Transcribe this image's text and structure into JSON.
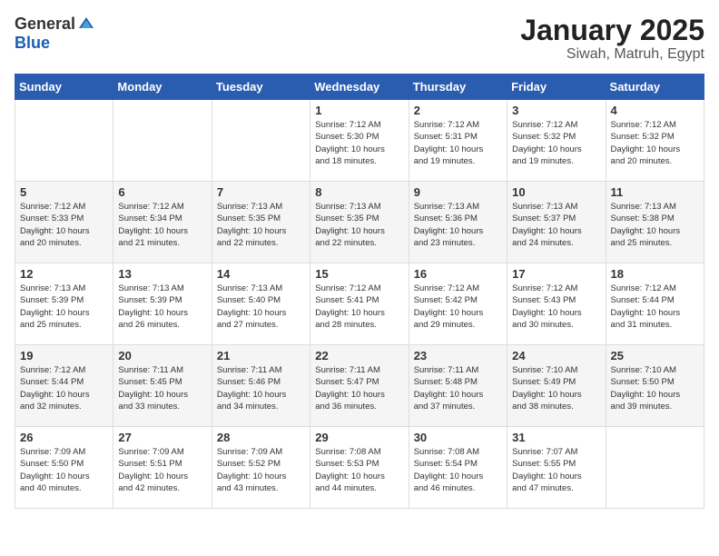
{
  "header": {
    "logo_general": "General",
    "logo_blue": "Blue",
    "month": "January 2025",
    "location": "Siwah, Matruh, Egypt"
  },
  "days_of_week": [
    "Sunday",
    "Monday",
    "Tuesday",
    "Wednesday",
    "Thursday",
    "Friday",
    "Saturday"
  ],
  "weeks": [
    [
      {
        "day": "",
        "info": ""
      },
      {
        "day": "",
        "info": ""
      },
      {
        "day": "",
        "info": ""
      },
      {
        "day": "1",
        "info": "Sunrise: 7:12 AM\nSunset: 5:30 PM\nDaylight: 10 hours\nand 18 minutes."
      },
      {
        "day": "2",
        "info": "Sunrise: 7:12 AM\nSunset: 5:31 PM\nDaylight: 10 hours\nand 19 minutes."
      },
      {
        "day": "3",
        "info": "Sunrise: 7:12 AM\nSunset: 5:32 PM\nDaylight: 10 hours\nand 19 minutes."
      },
      {
        "day": "4",
        "info": "Sunrise: 7:12 AM\nSunset: 5:32 PM\nDaylight: 10 hours\nand 20 minutes."
      }
    ],
    [
      {
        "day": "5",
        "info": "Sunrise: 7:12 AM\nSunset: 5:33 PM\nDaylight: 10 hours\nand 20 minutes."
      },
      {
        "day": "6",
        "info": "Sunrise: 7:12 AM\nSunset: 5:34 PM\nDaylight: 10 hours\nand 21 minutes."
      },
      {
        "day": "7",
        "info": "Sunrise: 7:13 AM\nSunset: 5:35 PM\nDaylight: 10 hours\nand 22 minutes."
      },
      {
        "day": "8",
        "info": "Sunrise: 7:13 AM\nSunset: 5:35 PM\nDaylight: 10 hours\nand 22 minutes."
      },
      {
        "day": "9",
        "info": "Sunrise: 7:13 AM\nSunset: 5:36 PM\nDaylight: 10 hours\nand 23 minutes."
      },
      {
        "day": "10",
        "info": "Sunrise: 7:13 AM\nSunset: 5:37 PM\nDaylight: 10 hours\nand 24 minutes."
      },
      {
        "day": "11",
        "info": "Sunrise: 7:13 AM\nSunset: 5:38 PM\nDaylight: 10 hours\nand 25 minutes."
      }
    ],
    [
      {
        "day": "12",
        "info": "Sunrise: 7:13 AM\nSunset: 5:39 PM\nDaylight: 10 hours\nand 25 minutes."
      },
      {
        "day": "13",
        "info": "Sunrise: 7:13 AM\nSunset: 5:39 PM\nDaylight: 10 hours\nand 26 minutes."
      },
      {
        "day": "14",
        "info": "Sunrise: 7:13 AM\nSunset: 5:40 PM\nDaylight: 10 hours\nand 27 minutes."
      },
      {
        "day": "15",
        "info": "Sunrise: 7:12 AM\nSunset: 5:41 PM\nDaylight: 10 hours\nand 28 minutes."
      },
      {
        "day": "16",
        "info": "Sunrise: 7:12 AM\nSunset: 5:42 PM\nDaylight: 10 hours\nand 29 minutes."
      },
      {
        "day": "17",
        "info": "Sunrise: 7:12 AM\nSunset: 5:43 PM\nDaylight: 10 hours\nand 30 minutes."
      },
      {
        "day": "18",
        "info": "Sunrise: 7:12 AM\nSunset: 5:44 PM\nDaylight: 10 hours\nand 31 minutes."
      }
    ],
    [
      {
        "day": "19",
        "info": "Sunrise: 7:12 AM\nSunset: 5:44 PM\nDaylight: 10 hours\nand 32 minutes."
      },
      {
        "day": "20",
        "info": "Sunrise: 7:11 AM\nSunset: 5:45 PM\nDaylight: 10 hours\nand 33 minutes."
      },
      {
        "day": "21",
        "info": "Sunrise: 7:11 AM\nSunset: 5:46 PM\nDaylight: 10 hours\nand 34 minutes."
      },
      {
        "day": "22",
        "info": "Sunrise: 7:11 AM\nSunset: 5:47 PM\nDaylight: 10 hours\nand 36 minutes."
      },
      {
        "day": "23",
        "info": "Sunrise: 7:11 AM\nSunset: 5:48 PM\nDaylight: 10 hours\nand 37 minutes."
      },
      {
        "day": "24",
        "info": "Sunrise: 7:10 AM\nSunset: 5:49 PM\nDaylight: 10 hours\nand 38 minutes."
      },
      {
        "day": "25",
        "info": "Sunrise: 7:10 AM\nSunset: 5:50 PM\nDaylight: 10 hours\nand 39 minutes."
      }
    ],
    [
      {
        "day": "26",
        "info": "Sunrise: 7:09 AM\nSunset: 5:50 PM\nDaylight: 10 hours\nand 40 minutes."
      },
      {
        "day": "27",
        "info": "Sunrise: 7:09 AM\nSunset: 5:51 PM\nDaylight: 10 hours\nand 42 minutes."
      },
      {
        "day": "28",
        "info": "Sunrise: 7:09 AM\nSunset: 5:52 PM\nDaylight: 10 hours\nand 43 minutes."
      },
      {
        "day": "29",
        "info": "Sunrise: 7:08 AM\nSunset: 5:53 PM\nDaylight: 10 hours\nand 44 minutes."
      },
      {
        "day": "30",
        "info": "Sunrise: 7:08 AM\nSunset: 5:54 PM\nDaylight: 10 hours\nand 46 minutes."
      },
      {
        "day": "31",
        "info": "Sunrise: 7:07 AM\nSunset: 5:55 PM\nDaylight: 10 hours\nand 47 minutes."
      },
      {
        "day": "",
        "info": ""
      }
    ]
  ]
}
